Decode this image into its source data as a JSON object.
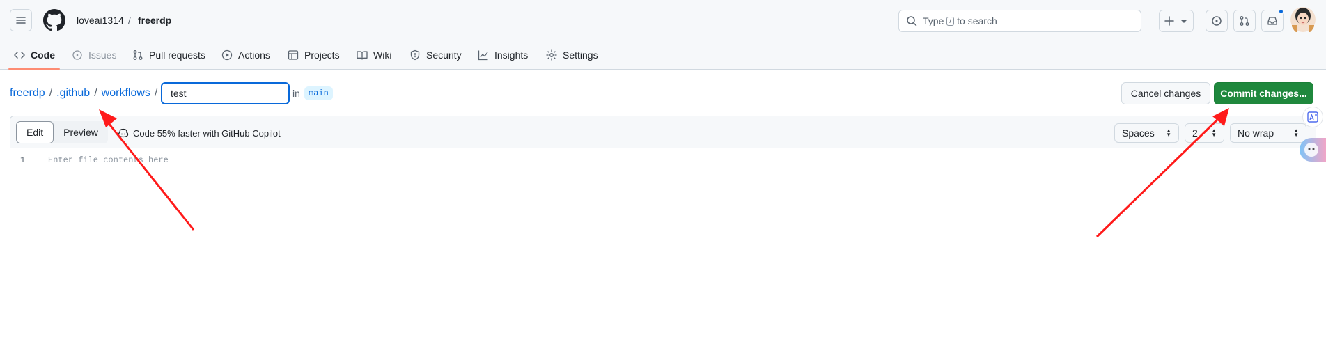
{
  "header": {
    "owner": "loveai1314",
    "separator": "/",
    "repo": "freerdp",
    "search": {
      "prefix": "Type",
      "key": "/",
      "suffix": "to search"
    }
  },
  "nav": [
    {
      "label": "Code",
      "icon": "code-icon",
      "state": "active"
    },
    {
      "label": "Issues",
      "icon": "issue-opened-icon",
      "state": "disabled"
    },
    {
      "label": "Pull requests",
      "icon": "git-pull-request-icon",
      "state": "normal"
    },
    {
      "label": "Actions",
      "icon": "play-icon",
      "state": "normal"
    },
    {
      "label": "Projects",
      "icon": "table-icon",
      "state": "normal"
    },
    {
      "label": "Wiki",
      "icon": "book-icon",
      "state": "normal"
    },
    {
      "label": "Security",
      "icon": "shield-icon",
      "state": "normal"
    },
    {
      "label": "Insights",
      "icon": "graph-icon",
      "state": "normal"
    },
    {
      "label": "Settings",
      "icon": "gear-icon",
      "state": "normal"
    }
  ],
  "path": {
    "segments": [
      "freerdp",
      ".github",
      "workflows"
    ],
    "separator": "/",
    "filename": "test",
    "in_label": "in",
    "branch": "main"
  },
  "actions": {
    "cancel": "Cancel changes",
    "commit": "Commit changes..."
  },
  "editor": {
    "tab_edit": "Edit",
    "tab_preview": "Preview",
    "copilot": "Code 55% faster with GitHub Copilot",
    "indent_mode": "Spaces",
    "indent_size": "2",
    "wrap_mode": "No wrap",
    "line_number": "1",
    "placeholder": "Enter file contents here"
  },
  "colors": {
    "accent": "#0969da",
    "commit_green": "#1f883d",
    "annotation_red": "#ff1a1a",
    "nav_underline": "#fd8c73"
  }
}
